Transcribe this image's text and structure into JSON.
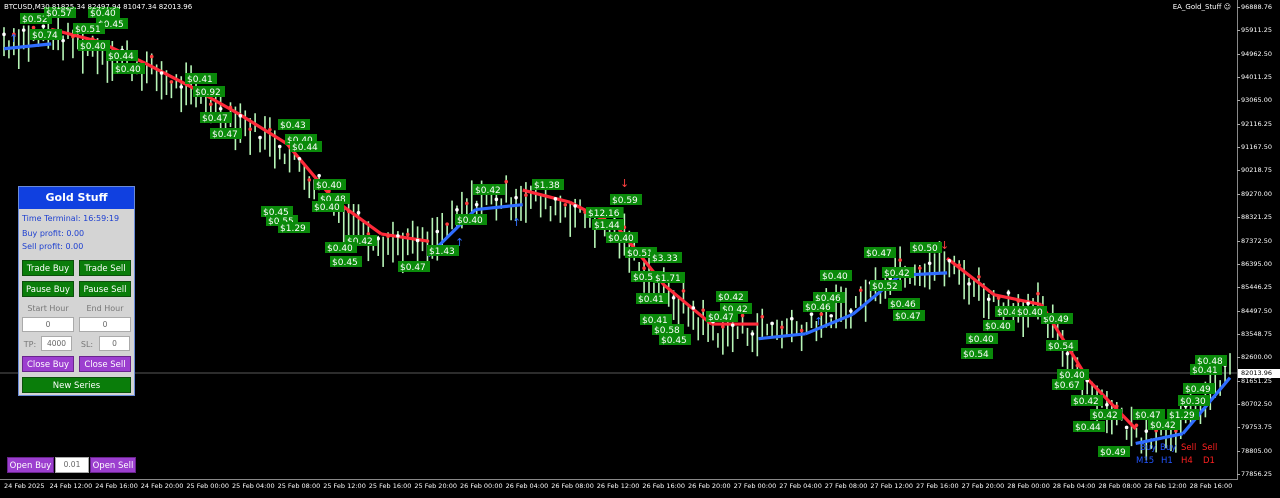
{
  "header": {
    "symbol_info": "BTCUSD,M30  81825.34 82497.94 81047.34 82013.96",
    "ea_name": "EA_Gold_Stuff"
  },
  "price_axis": {
    "ticks": [
      "96888.76",
      "95911.25",
      "94962.50",
      "94011.25",
      "93065.00",
      "92116.25",
      "91167.50",
      "90218.75",
      "89270.00",
      "88321.25",
      "87372.50",
      "86395.00",
      "85446.25",
      "84497.50",
      "83548.75",
      "82600.00",
      "81651.25",
      "80702.50",
      "79753.75",
      "78805.00",
      "77856.25"
    ],
    "current_price": "82013.96"
  },
  "time_axis": {
    "ticks": [
      "24 Feb 2025",
      "24 Feb 12:00",
      "24 Feb 16:00",
      "24 Feb 20:00",
      "25 Feb 00:00",
      "25 Feb 04:00",
      "25 Feb 08:00",
      "25 Feb 12:00",
      "25 Feb 16:00",
      "25 Feb 20:00",
      "26 Feb 00:00",
      "26 Feb 04:00",
      "26 Feb 08:00",
      "26 Feb 12:00",
      "26 Feb 16:00",
      "26 Feb 20:00",
      "27 Feb 00:00",
      "27 Feb 04:00",
      "27 Feb 08:00",
      "27 Feb 12:00",
      "27 Feb 16:00",
      "27 Feb 20:00",
      "28 Feb 00:00",
      "28 Feb 04:00",
      "28 Feb 08:00",
      "28 Feb 12:00",
      "28 Feb 16:00"
    ]
  },
  "chart_data": {
    "type": "line",
    "series": [
      {
        "name": "BTCUSD M30 close",
        "x": [
          "24 Feb 2025",
          "24 Feb 12:00",
          "24 Feb 16:00",
          "24 Feb 20:00",
          "25 Feb 00:00",
          "25 Feb 04:00",
          "25 Feb 08:00",
          "25 Feb 12:00",
          "25 Feb 16:00",
          "25 Feb 20:00",
          "26 Feb 00:00",
          "26 Feb 04:00",
          "26 Feb 08:00",
          "26 Feb 12:00",
          "26 Feb 16:00",
          "26 Feb 20:00",
          "27 Feb 00:00",
          "27 Feb 04:00",
          "27 Feb 08:00",
          "27 Feb 12:00",
          "27 Feb 16:00",
          "27 Feb 20:00",
          "28 Feb 00:00",
          "28 Feb 04:00",
          "28 Feb 08:00",
          "28 Feb 12:00",
          "28 Feb 16:00"
        ],
        "values": [
          95500,
          95700,
          95200,
          94300,
          93300,
          92200,
          91000,
          88700,
          87300,
          87000,
          88900,
          89100,
          88600,
          87600,
          85200,
          83600,
          83600,
          83800,
          84600,
          86200,
          86300,
          84800,
          84400,
          81300,
          79300,
          79700,
          82000
        ]
      }
    ],
    "ylim": [
      77500,
      97200
    ]
  },
  "trade_labels": [
    {
      "t": "$0.52",
      "x": 20,
      "y": 22
    },
    {
      "t": "$0.57",
      "x": 44,
      "y": 16
    },
    {
      "t": "$0.40",
      "x": 88,
      "y": 16
    },
    {
      "t": "$0.45",
      "x": 96,
      "y": 27
    },
    {
      "t": "$0.51",
      "x": 73,
      "y": 32
    },
    {
      "t": "$0.74",
      "x": 30,
      "y": 38
    },
    {
      "t": "$0.40",
      "x": 78,
      "y": 49
    },
    {
      "t": "$0.44",
      "x": 106,
      "y": 59
    },
    {
      "t": "$0.41",
      "x": 185,
      "y": 82
    },
    {
      "t": "$0.92",
      "x": 193,
      "y": 95
    },
    {
      "t": "$0.47",
      "x": 200,
      "y": 121
    },
    {
      "t": "$0.43",
      "x": 278,
      "y": 128
    },
    {
      "t": "$0.40",
      "x": 285,
      "y": 143
    },
    {
      "t": "$0.44",
      "x": 290,
      "y": 150
    },
    {
      "t": "$0.40",
      "x": 314,
      "y": 188
    },
    {
      "t": "$0.48",
      "x": 318,
      "y": 202
    },
    {
      "t": "$0.40",
      "x": 312,
      "y": 210
    },
    {
      "t": "$0.45",
      "x": 261,
      "y": 215
    },
    {
      "t": "$0.55",
      "x": 266,
      "y": 224
    },
    {
      "t": "$1.29",
      "x": 278,
      "y": 231
    },
    {
      "t": "$0.42",
      "x": 345,
      "y": 244
    },
    {
      "t": "$0.40",
      "x": 325,
      "y": 251
    },
    {
      "t": "$0.45",
      "x": 330,
      "y": 265
    },
    {
      "t": "$1.43",
      "x": 427,
      "y": 254
    },
    {
      "t": "$0.47",
      "x": 398,
      "y": 270
    },
    {
      "t": "$0.40",
      "x": 455,
      "y": 223
    },
    {
      "t": "$0.42",
      "x": 473,
      "y": 193
    },
    {
      "t": "$1.38",
      "x": 532,
      "y": 188
    },
    {
      "t": "$0.59",
      "x": 610,
      "y": 203
    },
    {
      "t": "$12.16",
      "x": 586,
      "y": 216
    },
    {
      "t": "$1.44",
      "x": 592,
      "y": 228
    },
    {
      "t": "$0.40",
      "x": 606,
      "y": 241
    },
    {
      "t": "$0.51",
      "x": 625,
      "y": 256
    },
    {
      "t": "$3.33",
      "x": 650,
      "y": 261
    },
    {
      "t": "$0.58",
      "x": 631,
      "y": 280
    },
    {
      "t": "$1.71",
      "x": 653,
      "y": 281
    },
    {
      "t": "$0.41",
      "x": 636,
      "y": 302
    },
    {
      "t": "$0.42",
      "x": 716,
      "y": 300
    },
    {
      "t": "$0.42",
      "x": 720,
      "y": 312
    },
    {
      "t": "$0.47",
      "x": 706,
      "y": 320
    },
    {
      "t": "$0.46",
      "x": 813,
      "y": 301
    },
    {
      "t": "$0.46",
      "x": 803,
      "y": 310
    },
    {
      "t": "$0.40",
      "x": 820,
      "y": 279
    },
    {
      "t": "$0.52",
      "x": 870,
      "y": 289
    },
    {
      "t": "$0.42",
      "x": 882,
      "y": 276
    },
    {
      "t": "$0.47",
      "x": 864,
      "y": 256
    },
    {
      "t": "$0.50",
      "x": 910,
      "y": 251
    },
    {
      "t": "$0.46",
      "x": 888,
      "y": 307
    },
    {
      "t": "$0.47",
      "x": 893,
      "y": 319
    },
    {
      "t": "$0.46",
      "x": 995,
      "y": 315
    },
    {
      "t": "$0.40",
      "x": 983,
      "y": 329
    },
    {
      "t": "$0.40",
      "x": 966,
      "y": 342
    },
    {
      "t": "$0.54",
      "x": 961,
      "y": 357
    },
    {
      "t": "$0.49",
      "x": 1041,
      "y": 322
    },
    {
      "t": "$0.54",
      "x": 1046,
      "y": 349
    },
    {
      "t": "$0.40",
      "x": 1057,
      "y": 378
    },
    {
      "t": "$0.67",
      "x": 1052,
      "y": 388
    },
    {
      "t": "$0.42",
      "x": 1071,
      "y": 404
    },
    {
      "t": "$0.44",
      "x": 1073,
      "y": 430
    },
    {
      "t": "$0.49",
      "x": 1098,
      "y": 455
    },
    {
      "t": "$0.42",
      "x": 1148,
      "y": 428
    },
    {
      "t": "$1.29",
      "x": 1167,
      "y": 418
    },
    {
      "t": "$0.30",
      "x": 1178,
      "y": 404
    },
    {
      "t": "$0.49",
      "x": 1183,
      "y": 392
    },
    {
      "t": "$0.41",
      "x": 1190,
      "y": 373
    },
    {
      "t": "$0.48",
      "x": 1195,
      "y": 364
    },
    {
      "t": "$0.47",
      "x": 1133,
      "y": 418
    },
    {
      "t": "$0.41",
      "x": 640,
      "y": 323
    },
    {
      "t": "$0.45",
      "x": 659,
      "y": 343
    },
    {
      "t": "$0.58",
      "x": 652,
      "y": 333
    },
    {
      "t": "$0.40",
      "x": 113,
      "y": 72
    },
    {
      "t": "$0.47",
      "x": 210,
      "y": 137
    },
    {
      "t": "$0.42",
      "x": 1090,
      "y": 418
    },
    {
      "t": "$0.40",
      "x": 1015,
      "y": 315
    }
  ],
  "mtf_table": {
    "row1": [
      "Buy",
      "Buy",
      "Sell",
      "Sell"
    ],
    "row2": [
      "M15",
      "H1",
      "H4",
      "D1"
    ],
    "colors": [
      "#2255ff",
      "#2255ff",
      "#ff2020",
      "#ff2020"
    ]
  },
  "panel": {
    "title": "Gold Stuff",
    "time_terminal": "Time Terminal: 16:59:19",
    "buy_profit": "Buy profit: 0.00",
    "sell_profit": "Sell profit: 0.00",
    "trade_buy": "Trade Buy",
    "trade_sell": "Trade Sell",
    "pause_buy": "Pause Buy",
    "pause_sell": "Pause Sell",
    "start_hour_label": "Start Hour",
    "end_hour_label": "End Hour",
    "start_hour_value": "0",
    "end_hour_value": "0",
    "tp_label": "TP:",
    "tp_value": "4000",
    "sl_label": "SL:",
    "sl_value": "0",
    "close_buy": "Close Buy",
    "close_sell": "Close Sell",
    "new_series": "New Series"
  },
  "bottom_bar": {
    "open_buy": "Open Buy",
    "lot_value": "0.01",
    "open_sell": "Open Sell"
  },
  "colors": {
    "background": "#000000",
    "candle": "#b7f5b7",
    "trend_down": "#ff2a3a",
    "trend_up": "#2f6dff",
    "label_bg": "#0a8a0a",
    "panel_title": "#1040e0",
    "button_green": "#0a7d0a",
    "button_purple": "#9c3fcf"
  }
}
